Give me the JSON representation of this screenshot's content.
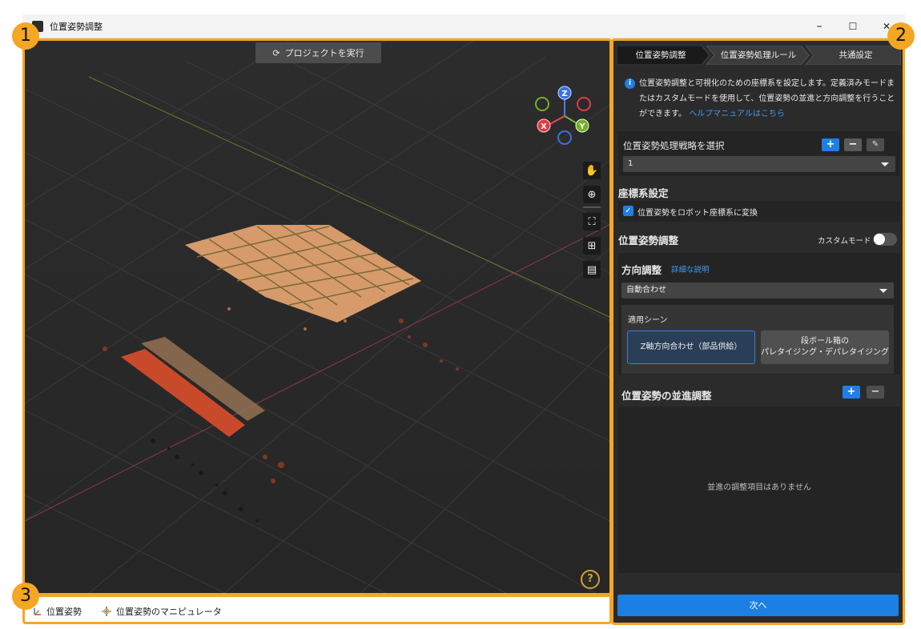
{
  "window": {
    "title": "位置姿勢調整",
    "minimize": "–",
    "maximize": "☐",
    "close": "✕"
  },
  "viewport": {
    "run_button": "プロジェクトを実行",
    "help": "?",
    "axes": {
      "z": "Z",
      "x": "X",
      "y": "Y"
    },
    "tools": [
      "hand-icon",
      "zoom-icon",
      "fit-view-icon",
      "grid-icon",
      "overlay-icon"
    ]
  },
  "bottom": {
    "pose_label": "位置姿勢",
    "manipulator_label": "位置姿勢のマニピュレータ"
  },
  "panel": {
    "tabs": [
      "位置姿勢調整",
      "位置姿勢処理ルール",
      "共通設定"
    ],
    "info_text": "位置姿勢調整と可視化のための座標系を設定します。定義済みモードまたはカスタムモードを使用して、位置姿勢の並進と方向調整を行うことができます。",
    "info_link": "ヘルプマニュアルはこちら",
    "strategy_label": "位置姿勢処理戦略を選択",
    "strategy_value": "1",
    "coord_heading": "座標系設定",
    "coord_checkbox": "位置姿勢をロボット座標系に変換",
    "pose_adjust_heading": "位置姿勢調整",
    "custom_mode_label": "カスタムモード",
    "direction_heading": "方向調整",
    "direction_link": "詳細な説明",
    "direction_value": "自動合わせ",
    "scene_label": "適用シーン",
    "scene_option_1": "Z軸方向合わせ（部品供給）",
    "scene_option_2_line1": "段ボール箱の",
    "scene_option_2_line2": "パレタイジング・デパレタイジング",
    "translation_heading": "位置姿勢の並進調整",
    "translation_empty": "並進の調整項目はありません",
    "next_button": "次へ"
  },
  "annotations": [
    "1",
    "2",
    "3"
  ],
  "colors": {
    "accent_blue": "#1f7fe5",
    "highlight_orange": "#f5a623"
  }
}
